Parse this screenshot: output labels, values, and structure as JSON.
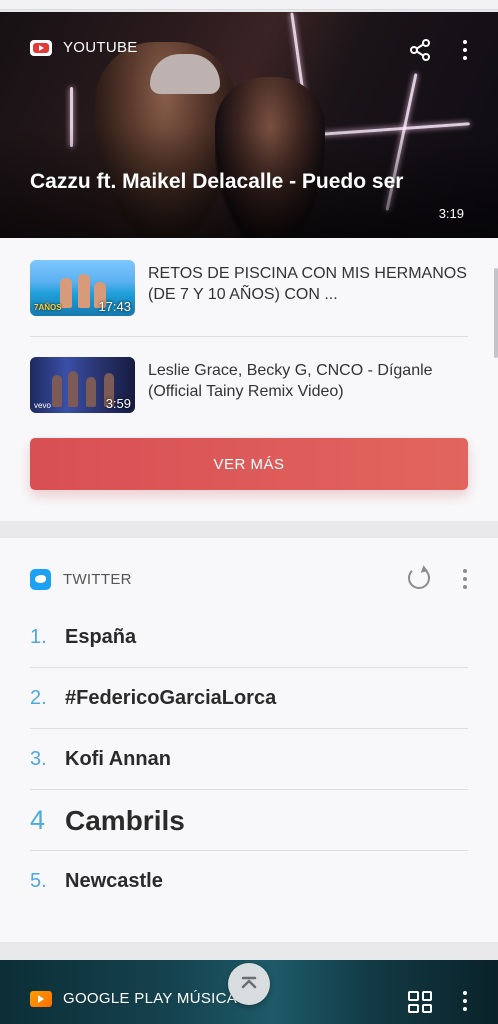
{
  "youtube": {
    "label": "YOUTUBE",
    "featured": {
      "title": "Cazzu ft. Maikel Delacalle - Puedo ser",
      "duration": "3:19"
    },
    "videos": [
      {
        "title": "RETOS DE PISCINA CON MIS HERMANOS (DE 7 Y 10 AÑOS) CON ...",
        "duration": "17:43",
        "thumb_tag": "7AÑOS"
      },
      {
        "title": "Leslie Grace, Becky G, CNCO - Díganle (Official Tainy Remix Video)",
        "duration": "3:59",
        "thumb_tag": "vevo"
      }
    ],
    "more_button": "VER MÁS",
    "icons": {
      "logo": "youtube-logo-icon",
      "share": "share-icon",
      "menu": "more-vert-icon"
    }
  },
  "twitter": {
    "label": "TWITTER",
    "trends": [
      {
        "rank": "1.",
        "text": "España"
      },
      {
        "rank": "2.",
        "text": "#FedericoGarciaLorca"
      },
      {
        "rank": "3.",
        "text": "Kofi Annan"
      },
      {
        "rank": "4",
        "text": "Cambrils"
      },
      {
        "rank": "5.",
        "text": "Newcastle"
      }
    ],
    "icons": {
      "logo": "twitter-logo-icon",
      "refresh": "refresh-icon",
      "menu": "more-vert-icon"
    }
  },
  "google_play": {
    "label": "GOOGLE PLAY MÚSICA",
    "icons": {
      "logo": "google-play-music-logo-icon",
      "apps": "apps-grid-icon",
      "menu": "more-vert-icon",
      "scroll_top": "chevron-up-icon"
    }
  },
  "colors": {
    "youtube_red": "#e53935",
    "button_red": "#dd5a5a",
    "twitter_blue": "#1da1f2",
    "trend_number": "#4fa8df"
  }
}
